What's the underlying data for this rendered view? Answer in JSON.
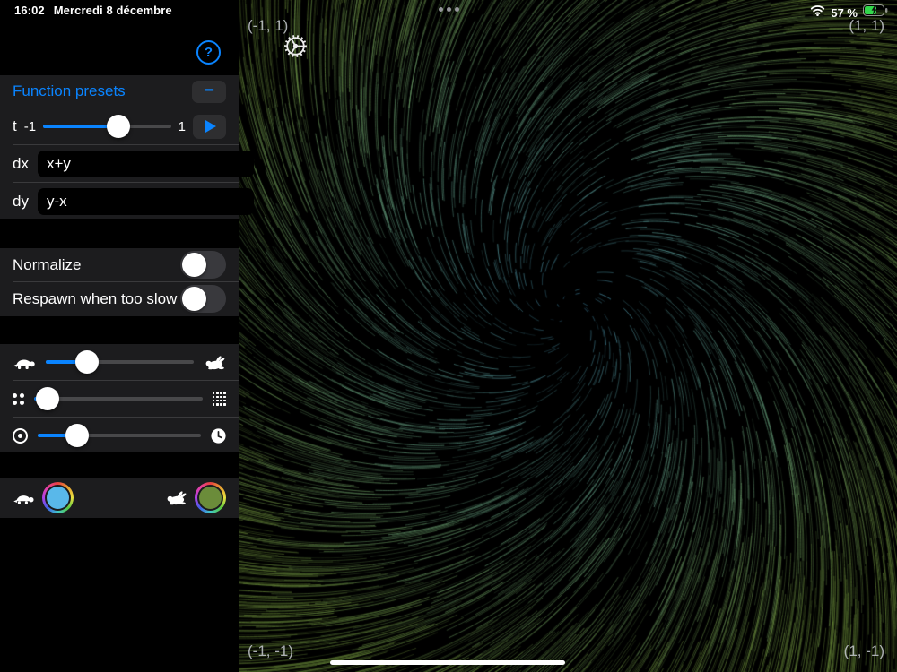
{
  "status_bar": {
    "time": "16:02",
    "date": "Mercredi 8 décembre",
    "wifi_icon": "wifi",
    "battery_level": "57 %",
    "battery_charging": true
  },
  "sidebar": {
    "help": {
      "label": "?"
    },
    "function_presets": {
      "title": "Function presets",
      "collapse_label": "−",
      "t_slider": {
        "label": "t",
        "min_label": "-1",
        "max_label": "1",
        "fraction": 0.59
      },
      "fields": [
        {
          "label": "dx",
          "value": "x+y"
        },
        {
          "label": "dy",
          "value": "y-x"
        }
      ]
    },
    "toggles": [
      {
        "label": "Normalize",
        "on": false
      },
      {
        "label": "Respawn when too slow",
        "on": false
      }
    ],
    "sliders": [
      {
        "name": "speed",
        "left_icon": "turtle",
        "right_icon": "hare",
        "fraction": 0.28
      },
      {
        "name": "particle-density",
        "left_icon": "dots-sparse",
        "right_icon": "dots-dense",
        "fraction": 0.08
      },
      {
        "name": "trail-length",
        "left_icon": "ring-dot",
        "right_icon": "clock",
        "fraction": 0.24
      }
    ],
    "color_pickers": [
      {
        "icon": "turtle",
        "color": "#59b8ea"
      },
      {
        "icon": "hare",
        "color": "#6b8c3a"
      }
    ]
  },
  "canvas": {
    "background": "#000000",
    "corner_labels": {
      "top_left": "(-1, 1)",
      "top_right": "(1, 1)",
      "bottom_left": "(-1, -1)",
      "bottom_right": "(1, -1)"
    },
    "gear_icon": "settings-gear"
  }
}
